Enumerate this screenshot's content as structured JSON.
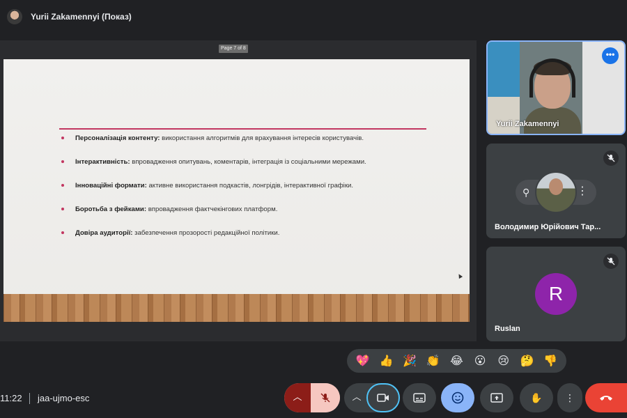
{
  "header": {
    "presenter_title": "Yurii Zakamennyi (Показ)"
  },
  "slide": {
    "page_indicator": "Page 7 of 8",
    "bullets": [
      {
        "bold": "Персоналізація контенту:",
        "text": " використання алгоритмів для врахування інтересів користувачів."
      },
      {
        "bold": "Інтерактивність:",
        "text": " впровадження опитувань, коментарів, інтеграція із соціальними мережами."
      },
      {
        "bold": "Інноваційні формати:",
        "text": " активне використання подкастів, лонгрідів, інтерактивної графіки."
      },
      {
        "bold": "Боротьба з фейками:",
        "text": " впровадження фактчекінгових платформ."
      },
      {
        "bold": "Довіра аудиторії:",
        "text": " забезпечення прозорості редакційної політики."
      }
    ],
    "accent_color": "#c23660"
  },
  "participants": [
    {
      "name": "Yurii Zakamennyi",
      "state": "speaking-presenter"
    },
    {
      "name": "Володимир Юрійович Тар...",
      "state": "muted"
    },
    {
      "name": "Ruslan",
      "initial": "R",
      "state": "muted",
      "avatar_color": "#8e24aa"
    }
  ],
  "reactions": [
    "💖",
    "👍",
    "🎉",
    "👏",
    "😂",
    "😮",
    "😢",
    "🤔",
    "👎"
  ],
  "bottombar": {
    "time": "11:22",
    "meeting_code": "jaa-ujmo-esc"
  },
  "colors": {
    "leave": "#ea4335",
    "mic_muted": "#f6c7c0",
    "emoji_active": "#8ab4f8",
    "self_border": "#8ab4f8"
  }
}
